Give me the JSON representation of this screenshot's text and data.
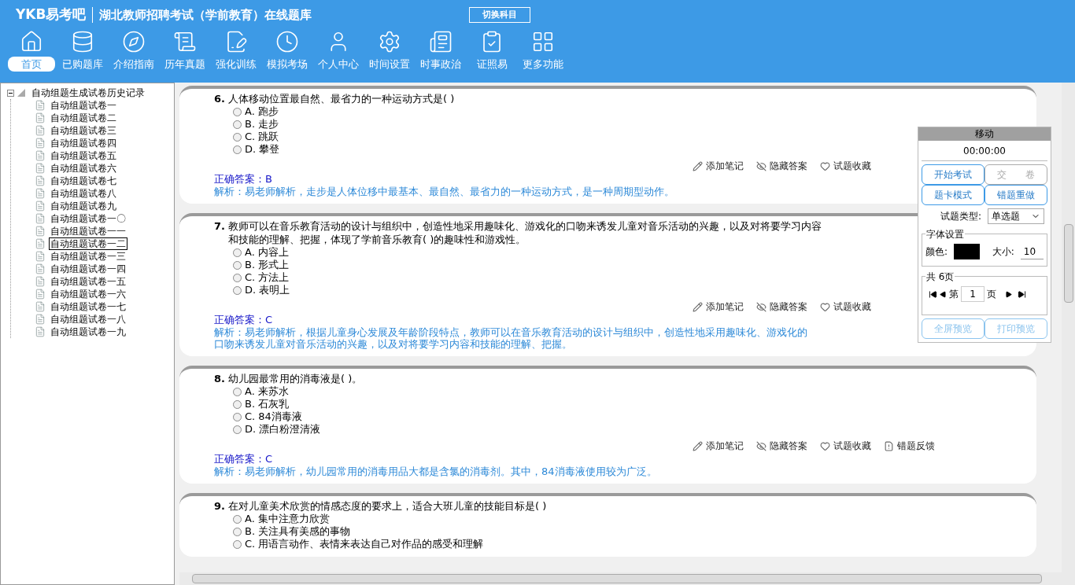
{
  "header": {
    "logo": "YKB易考吧",
    "title": "湖北教师招聘考试（学前教育）在线题库",
    "switch_button": "切换科目"
  },
  "nav": [
    {
      "label": "首页",
      "selected": true
    },
    {
      "label": "已购题库",
      "selected": false
    },
    {
      "label": "介绍指南",
      "selected": false
    },
    {
      "label": "历年真题",
      "selected": false
    },
    {
      "label": "强化训练",
      "selected": false
    },
    {
      "label": "模拟考场",
      "selected": false
    },
    {
      "label": "个人中心",
      "selected": false
    },
    {
      "label": "时间设置",
      "selected": false
    },
    {
      "label": "时事政治",
      "selected": false
    },
    {
      "label": "证照易",
      "selected": false
    },
    {
      "label": "更多功能",
      "selected": false
    }
  ],
  "tree": {
    "label": "自动组题生成试卷历史记录",
    "expanded": true,
    "children": [
      {
        "label": "自动组题试卷一",
        "selected": false
      },
      {
        "label": "自动组题试卷二",
        "selected": false
      },
      {
        "label": "自动组题试卷三",
        "selected": false
      },
      {
        "label": "自动组题试卷四",
        "selected": false
      },
      {
        "label": "自动组题试卷五",
        "selected": false
      },
      {
        "label": "自动组题试卷六",
        "selected": false
      },
      {
        "label": "自动组题试卷七",
        "selected": false
      },
      {
        "label": "自动组题试卷八",
        "selected": false
      },
      {
        "label": "自动组题试卷九",
        "selected": false
      },
      {
        "label": "自动组题试卷一〇",
        "selected": false
      },
      {
        "label": "自动组题试卷一一",
        "selected": false
      },
      {
        "label": "自动组题试卷一二",
        "selected": true
      },
      {
        "label": "自动组题试卷一三",
        "selected": false
      },
      {
        "label": "自动组题试卷一四",
        "selected": false
      },
      {
        "label": "自动组题试卷一五",
        "selected": false
      },
      {
        "label": "自动组题试卷一六",
        "selected": false
      },
      {
        "label": "自动组题试卷一七",
        "selected": false
      },
      {
        "label": "自动组题试卷一八",
        "selected": false
      },
      {
        "label": "自动组题试卷一九",
        "selected": false
      }
    ]
  },
  "questions": [
    {
      "number": "6.",
      "text": [
        "人体移动位置最自然、最省力的一种运动方式是( )"
      ],
      "options": [
        {
          "label": "A. 跑步",
          "checked": false
        },
        {
          "label": "B. 走步",
          "checked": false
        },
        {
          "label": "C. 跳跃",
          "checked": false
        },
        {
          "label": "D. 攀登",
          "checked": false
        }
      ],
      "actions": [
        "添加笔记",
        "隐藏答案",
        "试题收藏"
      ],
      "answer": "正确答案：B",
      "analysis": [
        "解析：易老师解析，走步是人体位移中最基本、最自然、最省力的一种运动方式，是一种周期型动作。"
      ]
    },
    {
      "number": "7.",
      "text": [
        "教师可以在音乐教育活动的设计与组织中，创造性地采用趣味化、游戏化的口吻来诱发儿童对音乐活动的兴趣，以及对将要学习内容",
        "和技能的理解、把握，体现了学前音乐教育( )的趣味性和游戏性。"
      ],
      "options": [
        {
          "label": "A. 内容上",
          "checked": false
        },
        {
          "label": "B. 形式上",
          "checked": false
        },
        {
          "label": "C. 方法上",
          "checked": false
        },
        {
          "label": "D. 表明上",
          "checked": false
        }
      ],
      "actions": [
        "添加笔记",
        "隐藏答案",
        "试题收藏"
      ],
      "answer": "正确答案：C",
      "analysis": [
        "解析：易老师解析，根据儿童身心发展及年龄阶段特点，教师可以在音乐教育活动的设计与组织中，创造性地采用趣味化、游戏化的",
        "口吻来诱发儿童对音乐活动的兴趣，以及对将要学习内容和技能的理解、把握。"
      ]
    },
    {
      "number": "8.",
      "text": [
        "幼儿园最常用的消毒液是( )。"
      ],
      "options": [
        {
          "label": "A. 来苏水",
          "checked": false
        },
        {
          "label": "B. 石灰乳",
          "checked": false
        },
        {
          "label": "C. 84消毒液",
          "checked": false
        },
        {
          "label": "D. 漂白粉澄清液",
          "checked": false
        }
      ],
      "actions": [
        "添加笔记",
        "隐藏答案",
        "试题收藏",
        "错题反馈"
      ],
      "answer": "正确答案：C",
      "analysis": [
        "解析：易老师解析，幼儿园常用的消毒用品大都是含氯的消毒剂。其中，84消毒液使用较为广泛。"
      ]
    },
    {
      "number": "9.",
      "text": [
        "在对儿童美术欣赏的情感态度的要求上，适合大班儿童的技能目标是( )"
      ],
      "options": [
        {
          "label": "A. 集中注意力欣赏",
          "checked": false
        },
        {
          "label": "B. 关注具有美感的事物",
          "checked": false
        },
        {
          "label": "C. 用语言动作、表情来表达自己对作品的感受和理解",
          "checked": false
        }
      ]
    }
  ],
  "panel": {
    "title": "移动",
    "timer": "00:00:00",
    "buttons": [
      {
        "label": "开始考试",
        "disabled": false
      },
      {
        "label": "交　　卷",
        "disabled": true
      },
      {
        "label": "题卡模式",
        "disabled": false
      },
      {
        "label": "错题重做",
        "disabled": false
      }
    ],
    "type_label": "试题类型:",
    "type_value": "单选题",
    "font_group": "字体设置",
    "color_label": "颜色:",
    "color": "#000000",
    "size_label": "大小:",
    "size_value": "10",
    "page_group": "共 6页",
    "page_prefix": "第",
    "page_value": "1",
    "page_suffix": "页",
    "bottom_buttons": [
      {
        "label": "全屏预览",
        "disabled": true
      },
      {
        "label": "打印预览",
        "disabled": true
      }
    ]
  }
}
